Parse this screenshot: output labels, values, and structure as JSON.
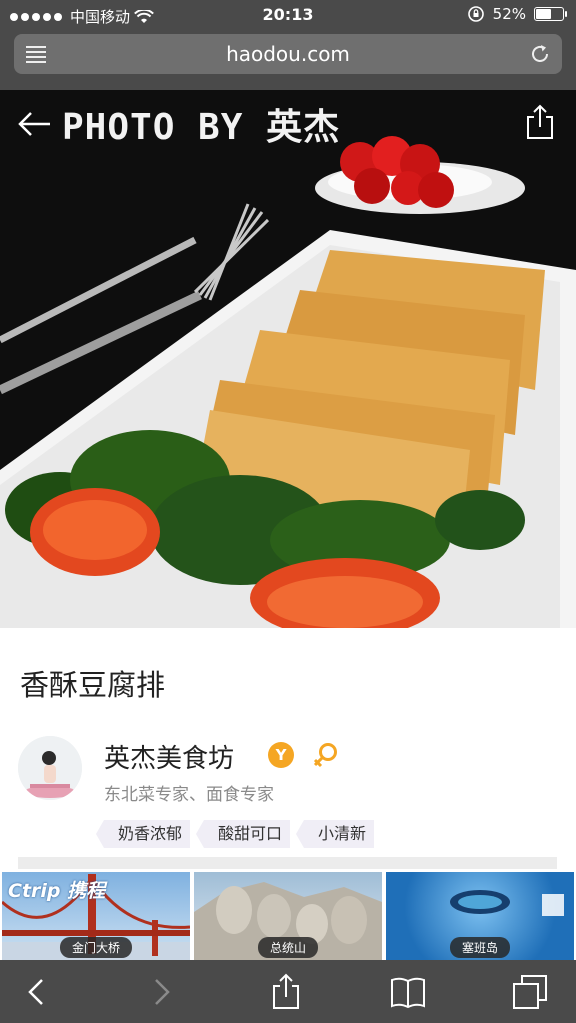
{
  "status_bar": {
    "carrier": "中国移动",
    "time": "20:13",
    "battery_percent": "52%",
    "battery_level": 0.52
  },
  "browser": {
    "url": "haodou.com"
  },
  "hero": {
    "watermark": "PHOTO BY 英杰"
  },
  "recipe": {
    "title": "香酥豆腐排",
    "author": "英杰美食坊",
    "verified_badge": "Y",
    "author_subtitle": "东北菜专家、面食专家",
    "tags": [
      "奶香浓郁",
      "酸甜可口",
      "小清新"
    ]
  },
  "ads": [
    {
      "logo": "Ctrip 携程",
      "caption": "金门大桥"
    },
    {
      "caption": "总统山"
    },
    {
      "caption": "塞班岛"
    }
  ],
  "colors": {
    "chrome": "#4a4a4a",
    "badge": "#f5a623",
    "tag_bg": "#f0eef6"
  },
  "icons": {
    "back": "arrow-left-icon",
    "share": "share-icon",
    "reload": "reload-icon",
    "menu": "reader-menu-icon",
    "bookmarks": "book-icon",
    "tabs": "tabs-icon"
  }
}
